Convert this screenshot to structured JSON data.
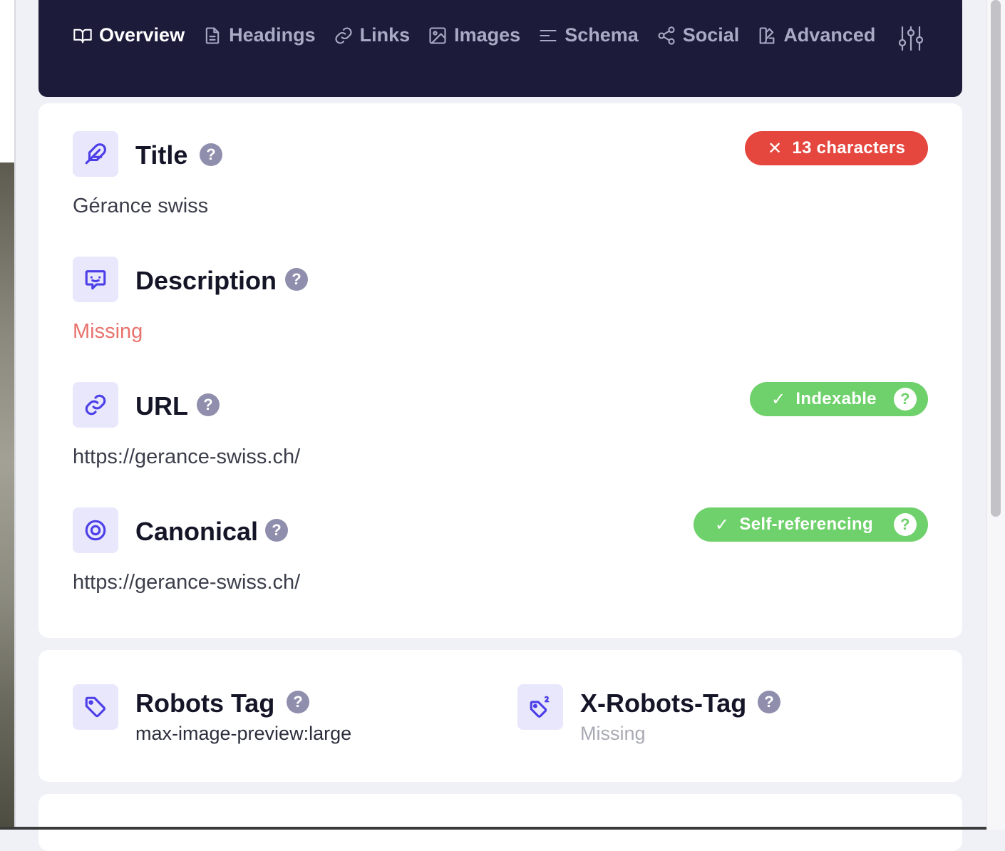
{
  "nav": {
    "tabs": [
      {
        "label": "Overview",
        "icon": "book-open-icon",
        "active": true
      },
      {
        "label": "Headings",
        "icon": "document-icon",
        "active": false
      },
      {
        "label": "Links",
        "icon": "link-icon",
        "active": false
      },
      {
        "label": "Images",
        "icon": "image-icon",
        "active": false
      },
      {
        "label": "Schema",
        "icon": "list-icon",
        "active": false
      },
      {
        "label": "Social",
        "icon": "share-icon",
        "active": false
      },
      {
        "label": "Advanced",
        "icon": "swatch-icon",
        "active": false
      }
    ],
    "settings_icon": "sliders-icon"
  },
  "overview": {
    "title": {
      "label": "Title",
      "help": "?",
      "value": "Gérance swiss",
      "badge": {
        "mark": "✕",
        "text": "13 characters",
        "color": "#e5473f"
      }
    },
    "description": {
      "label": "Description",
      "help": "?",
      "value": "Missing"
    },
    "url": {
      "label": "URL",
      "help": "?",
      "value": "https://gerance-swiss.ch/",
      "badge": {
        "mark": "✓",
        "text": "Indexable",
        "help": "?",
        "color": "#6fd16b"
      }
    },
    "canonical": {
      "label": "Canonical",
      "help": "?",
      "value": "https://gerance-swiss.ch/",
      "badge": {
        "mark": "✓",
        "text": "Self-referencing",
        "help": "?",
        "color": "#6fd16b"
      }
    }
  },
  "robots": {
    "robots_tag": {
      "label": "Robots Tag",
      "help": "?",
      "value": "max-image-preview:large"
    },
    "x_robots_tag": {
      "label": "X-Robots-Tag",
      "help": "?",
      "value": "Missing"
    }
  },
  "colors": {
    "nav_bg": "#1c1b3a",
    "accent": "#4c3ee8",
    "icon_bg": "#e8e7fc",
    "error": "#e5473f",
    "success": "#6fd16b"
  }
}
